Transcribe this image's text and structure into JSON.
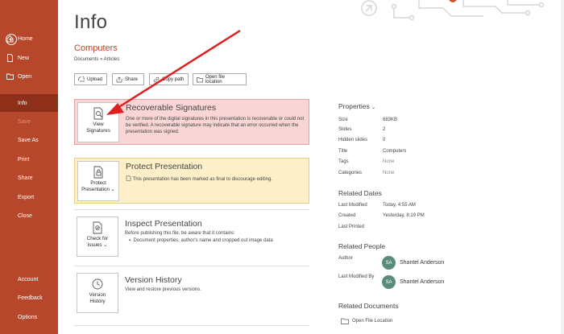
{
  "sidebar": {
    "items": [
      {
        "label": "Home",
        "icon": "home-icon"
      },
      {
        "label": "New",
        "icon": "new-document-icon"
      },
      {
        "label": "Open",
        "icon": "folder-icon"
      },
      {
        "label": "Info"
      },
      {
        "label": "Save"
      },
      {
        "label": "Save As"
      },
      {
        "label": "Print"
      },
      {
        "label": "Share"
      },
      {
        "label": "Export"
      },
      {
        "label": "Close"
      },
      {
        "label": "Account"
      },
      {
        "label": "Feedback"
      },
      {
        "label": "Options"
      }
    ],
    "active_index": 3,
    "accent": "#b7472a"
  },
  "main": {
    "title": "Info",
    "document": {
      "name": "Computers",
      "path": "Documents » Articles"
    },
    "toolbar": {
      "upload": "Upload",
      "share": "Share",
      "copy_path": "Copy path",
      "open_location": "Open file location"
    },
    "cards": {
      "signatures": {
        "button_label_1": "View",
        "button_label_2": "Signatures",
        "title": "Recoverable Signatures",
        "desc": "One or more of the digital signatures in this presentation is recoverable or could not be verified. A recoverable signature may indicate that an error occurred when the presentation was signed."
      },
      "protect": {
        "button_label_1": "Protect",
        "button_label_2": "Presentation",
        "title": "Protect Presentation",
        "desc": "This presentation has been marked as final to discourage editing."
      },
      "inspect": {
        "button_label_1": "Check for",
        "button_label_2": "Issues",
        "title": "Inspect Presentation",
        "desc": "Before publishing this file, be aware that it contains:",
        "bullet": "Document properties, author's name and cropped out image data"
      },
      "version": {
        "button_label_1": "Version",
        "button_label_2": "History",
        "title": "Version History",
        "desc": "View and restore previous versions."
      }
    }
  },
  "properties": {
    "heading": "Properties",
    "rows": [
      {
        "key": "Size",
        "value": "683KB"
      },
      {
        "key": "Slides",
        "value": "2"
      },
      {
        "key": "Hidden slides",
        "value": "0"
      },
      {
        "key": "Title",
        "value": "Computers"
      },
      {
        "key": "Tags",
        "value": "None"
      },
      {
        "key": "Categories",
        "value": "None"
      }
    ],
    "dates_heading": "Related Dates",
    "dates": [
      {
        "key": "Last Modified",
        "value": "Today, 4:55 AM"
      },
      {
        "key": "Created",
        "value": "Yesterday, 8:19 PM"
      },
      {
        "key": "Last Printed",
        "value": ""
      }
    ],
    "people_heading": "Related People",
    "author_key": "Author",
    "author_initials": "SA",
    "author_name": "Shantel Anderson",
    "modified_by_key": "Last Modified By",
    "modified_by_initials": "SA",
    "modified_by_name": "Shantel Anderson",
    "docs_heading": "Related Documents",
    "open_file_location": "Open File Location"
  }
}
